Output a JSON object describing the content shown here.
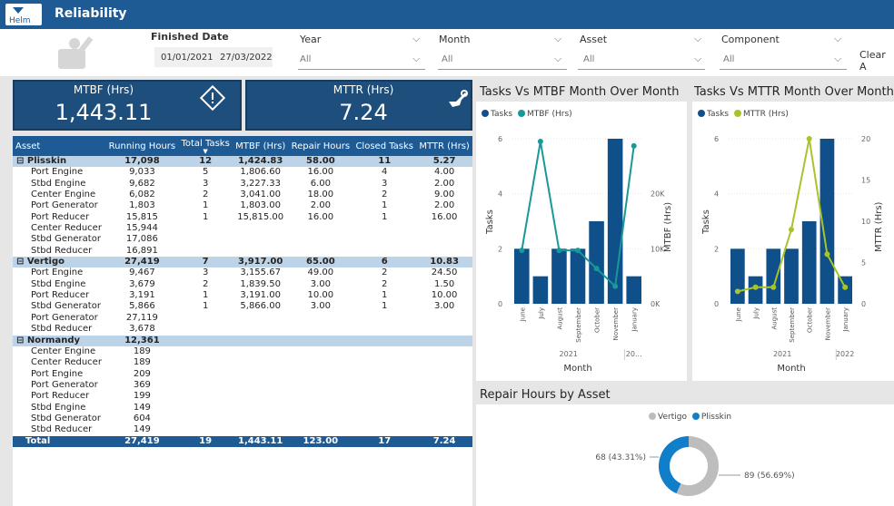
{
  "app": {
    "title": "Reliability"
  },
  "filters": {
    "finished_date": {
      "label": "Finished Date",
      "from": "01/01/2021",
      "to": "27/03/2022"
    },
    "year": {
      "label": "Year",
      "value": "All"
    },
    "month": {
      "label": "Month",
      "value": "All"
    },
    "asset": {
      "label": "Asset",
      "value": "All"
    },
    "component": {
      "label": "Component",
      "value": "All"
    },
    "clear_all": "Clear A"
  },
  "kpis": {
    "mtbf": {
      "label": "MTBF (Hrs)",
      "value": "1,443.11"
    },
    "mttr": {
      "label": "MTTR (Hrs)",
      "value": "7.24"
    }
  },
  "table": {
    "columns": [
      "Asset",
      "Running Hours",
      "Total Tasks",
      "MTBF (Hrs)",
      "Repair Hours",
      "Closed Tasks",
      "MTTR (Hrs)"
    ],
    "groups": [
      {
        "name": "Plisskin",
        "values": [
          "17,098",
          "12",
          "1,424.83",
          "58.00",
          "11",
          "5.27"
        ],
        "rows": [
          [
            "Port Engine",
            "9,033",
            "5",
            "1,806.60",
            "16.00",
            "4",
            "4.00"
          ],
          [
            "Stbd Engine",
            "9,682",
            "3",
            "3,227.33",
            "6.00",
            "3",
            "2.00"
          ],
          [
            "Center Engine",
            "6,082",
            "2",
            "3,041.00",
            "18.00",
            "2",
            "9.00"
          ],
          [
            "Port Generator",
            "1,803",
            "1",
            "1,803.00",
            "2.00",
            "1",
            "2.00"
          ],
          [
            "Port Reducer",
            "15,815",
            "1",
            "15,815.00",
            "16.00",
            "1",
            "16.00"
          ],
          [
            "Center Reducer",
            "15,944",
            "",
            "",
            "",
            "",
            ""
          ],
          [
            "Stbd Generator",
            "17,086",
            "",
            "",
            "",
            "",
            ""
          ],
          [
            "Stbd Reducer",
            "16,891",
            "",
            "",
            "",
            "",
            ""
          ]
        ]
      },
      {
        "name": "Vertigo",
        "values": [
          "27,419",
          "7",
          "3,917.00",
          "65.00",
          "6",
          "10.83"
        ],
        "rows": [
          [
            "Port Engine",
            "9,467",
            "3",
            "3,155.67",
            "49.00",
            "2",
            "24.50"
          ],
          [
            "Stbd Engine",
            "3,679",
            "2",
            "1,839.50",
            "3.00",
            "2",
            "1.50"
          ],
          [
            "Port Reducer",
            "3,191",
            "1",
            "3,191.00",
            "10.00",
            "1",
            "10.00"
          ],
          [
            "Stbd Generator",
            "5,866",
            "1",
            "5,866.00",
            "3.00",
            "1",
            "3.00"
          ],
          [
            "Port Generator",
            "27,119",
            "",
            "",
            "",
            "",
            ""
          ],
          [
            "Stbd Reducer",
            "3,678",
            "",
            "",
            "",
            "",
            ""
          ]
        ]
      },
      {
        "name": "Normandy",
        "values": [
          "12,361",
          "",
          "",
          "",
          "",
          ""
        ],
        "rows": [
          [
            "Center Engine",
            "189",
            "",
            "",
            "",
            "",
            ""
          ],
          [
            "Center Reducer",
            "189",
            "",
            "",
            "",
            "",
            ""
          ],
          [
            "Port Engine",
            "209",
            "",
            "",
            "",
            "",
            ""
          ],
          [
            "Port Generator",
            "369",
            "",
            "",
            "",
            "",
            ""
          ],
          [
            "Port Reducer",
            "199",
            "",
            "",
            "",
            "",
            ""
          ],
          [
            "Stbd Engine",
            "149",
            "",
            "",
            "",
            "",
            ""
          ],
          [
            "Stbd Generator",
            "604",
            "",
            "",
            "",
            "",
            ""
          ],
          [
            "Stbd Reducer",
            "149",
            "",
            "",
            "",
            "",
            ""
          ]
        ]
      }
    ],
    "total": [
      "Total",
      "27,419",
      "19",
      "1,443.11",
      "123.00",
      "17",
      "7.24"
    ]
  },
  "chart_data": [
    {
      "type": "bar",
      "title": "Tasks Vs MTBF Month Over Month",
      "categories": [
        "June",
        "July",
        "August",
        "September",
        "October",
        "November",
        "January"
      ],
      "year_labels": [
        "2021",
        "20..."
      ],
      "xlabel": "Month",
      "ylabel": "Tasks",
      "y2label": "MTBF (Hrs)",
      "ylim": [
        0,
        6
      ],
      "y2lim": [
        0,
        30000
      ],
      "yticks": [
        "0",
        "2",
        "4",
        "6"
      ],
      "y2ticks": [
        "0K",
        "10K",
        "20K"
      ],
      "series": [
        {
          "name": "Tasks",
          "type": "bar",
          "color": "#0f4f8a",
          "values": [
            2,
            1,
            2,
            2,
            3,
            6,
            1
          ]
        },
        {
          "name": "MTBF (Hrs)",
          "type": "line",
          "color": "#17999a",
          "values": [
            9700,
            29500,
            9700,
            9700,
            6400,
            3200,
            28700
          ]
        }
      ]
    },
    {
      "type": "bar",
      "title": "Tasks Vs MTTR Month Over Month",
      "categories": [
        "June",
        "July",
        "August",
        "September",
        "October",
        "November",
        "January"
      ],
      "year_labels": [
        "2021",
        "2022"
      ],
      "xlabel": "Month",
      "ylabel": "Tasks",
      "y2label": "MTTR (Hrs)",
      "ylim": [
        0,
        6
      ],
      "y2lim": [
        0,
        20
      ],
      "yticks": [
        "0",
        "2",
        "4",
        "6"
      ],
      "y2ticks": [
        "0",
        "5",
        "10",
        "15",
        "20"
      ],
      "series": [
        {
          "name": "Tasks",
          "type": "bar",
          "color": "#0f4f8a",
          "values": [
            2,
            1,
            2,
            2,
            3,
            6,
            1
          ]
        },
        {
          "name": "MTTR (Hrs)",
          "type": "line",
          "color": "#a8c42a",
          "values": [
            1.5,
            2,
            2,
            9,
            20,
            6,
            2
          ]
        }
      ]
    },
    {
      "type": "pie",
      "title": "Repair Hours by Asset",
      "series": [
        {
          "name": "Vertigo",
          "value": 89,
          "label": "89 (56.69%)",
          "color": "#bdbdbd"
        },
        {
          "name": "Plisskin",
          "value": 68,
          "label": "68 (43.31%)",
          "color": "#117ec9"
        }
      ]
    }
  ]
}
